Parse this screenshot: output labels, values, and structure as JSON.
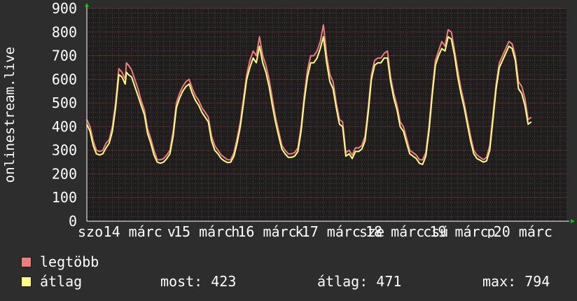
{
  "chart_data": {
    "type": "line",
    "ylabel": "onlinestream.live",
    "ylim": [
      0,
      900
    ],
    "yticks": [
      0,
      100,
      200,
      300,
      400,
      500,
      600,
      700,
      800,
      900
    ],
    "xlim": [
      0,
      7.5
    ],
    "xticks": [
      {
        "x": 0.0,
        "label": "szo"
      },
      {
        "x": 0.4,
        "label": "14 márc"
      },
      {
        "x": 1.4,
        "label": "v"
      },
      {
        "x": 1.5,
        "label": "15 márc"
      },
      {
        "x": 2.4,
        "label": "h"
      },
      {
        "x": 2.5,
        "label": "16 márc"
      },
      {
        "x": 3.4,
        "label": "k"
      },
      {
        "x": 3.5,
        "label": "17 márc"
      },
      {
        "x": 4.4,
        "label": "sze"
      },
      {
        "x": 4.5,
        "label": "18 márc"
      },
      {
        "x": 5.4,
        "label": "csü"
      },
      {
        "x": 5.5,
        "label": "19 márc"
      },
      {
        "x": 6.4,
        "label": "p"
      },
      {
        "x": 6.5,
        "label": "20 márc"
      }
    ],
    "grid": true,
    "colors": {
      "background": "#2d2d2d",
      "plot_background": "#1e1e1e",
      "grid_minor": "#5a3a3a",
      "grid_major": "#8a3a3a",
      "axis": "#ffffff",
      "arrow": "#00cc00",
      "max_series": "#f07c7c",
      "avg_series": "#ffff80"
    },
    "series": [
      {
        "name": "legtöbb",
        "color": "#f07c7c",
        "points": [
          [
            0.0,
            430
          ],
          [
            0.05,
            400
          ],
          [
            0.1,
            340
          ],
          [
            0.15,
            300
          ],
          [
            0.2,
            295
          ],
          [
            0.25,
            300
          ],
          [
            0.3,
            330
          ],
          [
            0.35,
            345
          ],
          [
            0.4,
            400
          ],
          [
            0.45,
            500
          ],
          [
            0.5,
            645
          ],
          [
            0.55,
            630
          ],
          [
            0.6,
            600
          ],
          [
            0.62,
            670
          ],
          [
            0.65,
            660
          ],
          [
            0.7,
            640
          ],
          [
            0.75,
            600
          ],
          [
            0.8,
            560
          ],
          [
            0.85,
            510
          ],
          [
            0.9,
            470
          ],
          [
            0.95,
            390
          ],
          [
            1.0,
            350
          ],
          [
            1.05,
            300
          ],
          [
            1.1,
            260
          ],
          [
            1.15,
            260
          ],
          [
            1.2,
            265
          ],
          [
            1.25,
            280
          ],
          [
            1.3,
            300
          ],
          [
            1.35,
            380
          ],
          [
            1.4,
            500
          ],
          [
            1.45,
            540
          ],
          [
            1.5,
            570
          ],
          [
            1.55,
            590
          ],
          [
            1.6,
            600
          ],
          [
            1.65,
            560
          ],
          [
            1.7,
            530
          ],
          [
            1.75,
            510
          ],
          [
            1.8,
            480
          ],
          [
            1.85,
            460
          ],
          [
            1.9,
            440
          ],
          [
            1.95,
            360
          ],
          [
            2.0,
            320
          ],
          [
            2.05,
            300
          ],
          [
            2.1,
            280
          ],
          [
            2.15,
            270
          ],
          [
            2.2,
            260
          ],
          [
            2.25,
            260
          ],
          [
            2.3,
            290
          ],
          [
            2.35,
            350
          ],
          [
            2.4,
            420
          ],
          [
            2.45,
            520
          ],
          [
            2.5,
            620
          ],
          [
            2.55,
            680
          ],
          [
            2.6,
            720
          ],
          [
            2.65,
            700
          ],
          [
            2.7,
            780
          ],
          [
            2.75,
            700
          ],
          [
            2.8,
            660
          ],
          [
            2.85,
            600
          ],
          [
            2.9,
            520
          ],
          [
            2.95,
            440
          ],
          [
            3.0,
            380
          ],
          [
            3.05,
            320
          ],
          [
            3.1,
            300
          ],
          [
            3.15,
            285
          ],
          [
            3.2,
            285
          ],
          [
            3.25,
            290
          ],
          [
            3.3,
            310
          ],
          [
            3.35,
            400
          ],
          [
            3.4,
            530
          ],
          [
            3.45,
            640
          ],
          [
            3.5,
            700
          ],
          [
            3.55,
            700
          ],
          [
            3.6,
            720
          ],
          [
            3.65,
            760
          ],
          [
            3.7,
            830
          ],
          [
            3.75,
            700
          ],
          [
            3.8,
            620
          ],
          [
            3.85,
            590
          ],
          [
            3.9,
            500
          ],
          [
            3.95,
            430
          ],
          [
            4.0,
            420
          ],
          [
            4.05,
            290
          ],
          [
            4.1,
            300
          ],
          [
            4.15,
            280
          ],
          [
            4.2,
            310
          ],
          [
            4.25,
            310
          ],
          [
            4.3,
            320
          ],
          [
            4.35,
            360
          ],
          [
            4.4,
            480
          ],
          [
            4.45,
            620
          ],
          [
            4.5,
            680
          ],
          [
            4.55,
            690
          ],
          [
            4.6,
            690
          ],
          [
            4.65,
            710
          ],
          [
            4.7,
            720
          ],
          [
            4.75,
            610
          ],
          [
            4.8,
            540
          ],
          [
            4.85,
            490
          ],
          [
            4.9,
            420
          ],
          [
            4.95,
            400
          ],
          [
            5.0,
            350
          ],
          [
            5.05,
            300
          ],
          [
            5.1,
            290
          ],
          [
            5.15,
            280
          ],
          [
            5.2,
            260
          ],
          [
            5.25,
            260
          ],
          [
            5.3,
            290
          ],
          [
            5.35,
            400
          ],
          [
            5.4,
            550
          ],
          [
            5.45,
            680
          ],
          [
            5.5,
            720
          ],
          [
            5.55,
            760
          ],
          [
            5.6,
            740
          ],
          [
            5.65,
            810
          ],
          [
            5.7,
            800
          ],
          [
            5.75,
            720
          ],
          [
            5.8,
            640
          ],
          [
            5.85,
            560
          ],
          [
            5.9,
            500
          ],
          [
            5.95,
            430
          ],
          [
            6.0,
            360
          ],
          [
            6.05,
            300
          ],
          [
            6.1,
            280
          ],
          [
            6.15,
            270
          ],
          [
            6.2,
            260
          ],
          [
            6.25,
            270
          ],
          [
            6.3,
            320
          ],
          [
            6.35,
            450
          ],
          [
            6.4,
            580
          ],
          [
            6.45,
            670
          ],
          [
            6.5,
            700
          ],
          [
            6.55,
            730
          ],
          [
            6.6,
            760
          ],
          [
            6.65,
            750
          ],
          [
            6.7,
            700
          ],
          [
            6.75,
            590
          ],
          [
            6.8,
            570
          ],
          [
            6.85,
            520
          ],
          [
            6.9,
            430
          ],
          [
            6.95,
            440
          ]
        ]
      },
      {
        "name": "átlag",
        "color": "#ffff80",
        "points": [
          [
            0.0,
            410
          ],
          [
            0.05,
            380
          ],
          [
            0.1,
            320
          ],
          [
            0.15,
            285
          ],
          [
            0.2,
            280
          ],
          [
            0.25,
            285
          ],
          [
            0.3,
            310
          ],
          [
            0.35,
            330
          ],
          [
            0.4,
            380
          ],
          [
            0.45,
            480
          ],
          [
            0.5,
            620
          ],
          [
            0.55,
            610
          ],
          [
            0.6,
            580
          ],
          [
            0.62,
            630
          ],
          [
            0.65,
            620
          ],
          [
            0.7,
            610
          ],
          [
            0.75,
            570
          ],
          [
            0.8,
            530
          ],
          [
            0.85,
            490
          ],
          [
            0.9,
            450
          ],
          [
            0.95,
            370
          ],
          [
            1.0,
            330
          ],
          [
            1.05,
            280
          ],
          [
            1.1,
            250
          ],
          [
            1.15,
            245
          ],
          [
            1.2,
            250
          ],
          [
            1.25,
            265
          ],
          [
            1.3,
            285
          ],
          [
            1.35,
            360
          ],
          [
            1.4,
            480
          ],
          [
            1.45,
            520
          ],
          [
            1.5,
            550
          ],
          [
            1.55,
            570
          ],
          [
            1.6,
            580
          ],
          [
            1.65,
            540
          ],
          [
            1.7,
            510
          ],
          [
            1.75,
            490
          ],
          [
            1.8,
            460
          ],
          [
            1.85,
            440
          ],
          [
            1.9,
            420
          ],
          [
            1.95,
            340
          ],
          [
            2.0,
            300
          ],
          [
            2.05,
            285
          ],
          [
            2.1,
            265
          ],
          [
            2.15,
            255
          ],
          [
            2.2,
            248
          ],
          [
            2.25,
            250
          ],
          [
            2.3,
            275
          ],
          [
            2.35,
            330
          ],
          [
            2.4,
            400
          ],
          [
            2.45,
            500
          ],
          [
            2.5,
            600
          ],
          [
            2.55,
            650
          ],
          [
            2.6,
            690
          ],
          [
            2.65,
            670
          ],
          [
            2.7,
            740
          ],
          [
            2.75,
            670
          ],
          [
            2.8,
            630
          ],
          [
            2.85,
            570
          ],
          [
            2.9,
            490
          ],
          [
            2.95,
            420
          ],
          [
            3.0,
            360
          ],
          [
            3.05,
            305
          ],
          [
            3.1,
            285
          ],
          [
            3.15,
            270
          ],
          [
            3.2,
            270
          ],
          [
            3.25,
            275
          ],
          [
            3.3,
            295
          ],
          [
            3.35,
            380
          ],
          [
            3.4,
            510
          ],
          [
            3.45,
            610
          ],
          [
            3.5,
            670
          ],
          [
            3.55,
            670
          ],
          [
            3.6,
            690
          ],
          [
            3.65,
            730
          ],
          [
            3.7,
            780
          ],
          [
            3.75,
            670
          ],
          [
            3.8,
            590
          ],
          [
            3.85,
            560
          ],
          [
            3.9,
            480
          ],
          [
            3.95,
            410
          ],
          [
            4.0,
            400
          ],
          [
            4.05,
            275
          ],
          [
            4.1,
            285
          ],
          [
            4.15,
            265
          ],
          [
            4.2,
            295
          ],
          [
            4.25,
            295
          ],
          [
            4.3,
            305
          ],
          [
            4.35,
            340
          ],
          [
            4.4,
            460
          ],
          [
            4.45,
            600
          ],
          [
            4.5,
            660
          ],
          [
            4.55,
            670
          ],
          [
            4.6,
            670
          ],
          [
            4.65,
            690
          ],
          [
            4.7,
            690
          ],
          [
            4.75,
            590
          ],
          [
            4.8,
            520
          ],
          [
            4.85,
            470
          ],
          [
            4.9,
            400
          ],
          [
            4.95,
            380
          ],
          [
            5.0,
            330
          ],
          [
            5.05,
            285
          ],
          [
            5.1,
            275
          ],
          [
            5.15,
            265
          ],
          [
            5.2,
            245
          ],
          [
            5.25,
            240
          ],
          [
            5.3,
            275
          ],
          [
            5.35,
            380
          ],
          [
            5.4,
            530
          ],
          [
            5.45,
            660
          ],
          [
            5.5,
            700
          ],
          [
            5.55,
            730
          ],
          [
            5.6,
            720
          ],
          [
            5.65,
            780
          ],
          [
            5.7,
            770
          ],
          [
            5.75,
            700
          ],
          [
            5.8,
            610
          ],
          [
            5.85,
            540
          ],
          [
            5.9,
            480
          ],
          [
            5.95,
            410
          ],
          [
            6.0,
            340
          ],
          [
            6.05,
            285
          ],
          [
            6.1,
            265
          ],
          [
            6.15,
            258
          ],
          [
            6.2,
            250
          ],
          [
            6.25,
            255
          ],
          [
            6.3,
            300
          ],
          [
            6.35,
            430
          ],
          [
            6.4,
            560
          ],
          [
            6.45,
            650
          ],
          [
            6.5,
            680
          ],
          [
            6.55,
            710
          ],
          [
            6.6,
            740
          ],
          [
            6.65,
            730
          ],
          [
            6.7,
            680
          ],
          [
            6.75,
            560
          ],
          [
            6.8,
            540
          ],
          [
            6.85,
            490
          ],
          [
            6.9,
            410
          ],
          [
            6.95,
            420
          ]
        ]
      }
    ]
  },
  "legend": {
    "max_label": "legtöbb",
    "avg_label": "átlag"
  },
  "stats": {
    "now": "most: 423",
    "avg": "átlag: 471",
    "max": "max: 794"
  }
}
